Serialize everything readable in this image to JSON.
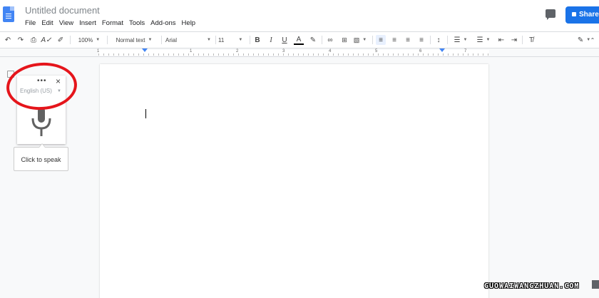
{
  "document": {
    "title": "Untitled document"
  },
  "menu": [
    "File",
    "Edit",
    "View",
    "Insert",
    "Format",
    "Tools",
    "Add-ons",
    "Help"
  ],
  "share": {
    "label": "Share"
  },
  "toolbar": {
    "zoom": "100%",
    "style": "Normal text",
    "font": "Arial",
    "size": "11",
    "bold": "B",
    "italic": "I",
    "underline": "U",
    "text_color": "A",
    "accent_color": "#1a73e8"
  },
  "ruler": {
    "numbers": [
      "1",
      "1",
      "2",
      "3",
      "4",
      "5",
      "6",
      "7"
    ]
  },
  "voice_typing": {
    "menu": "•••",
    "close": "×",
    "language": "English (US)",
    "tooltip": "Click to speak"
  },
  "watermark": "GUOWAIWANGZHUAN.COM"
}
